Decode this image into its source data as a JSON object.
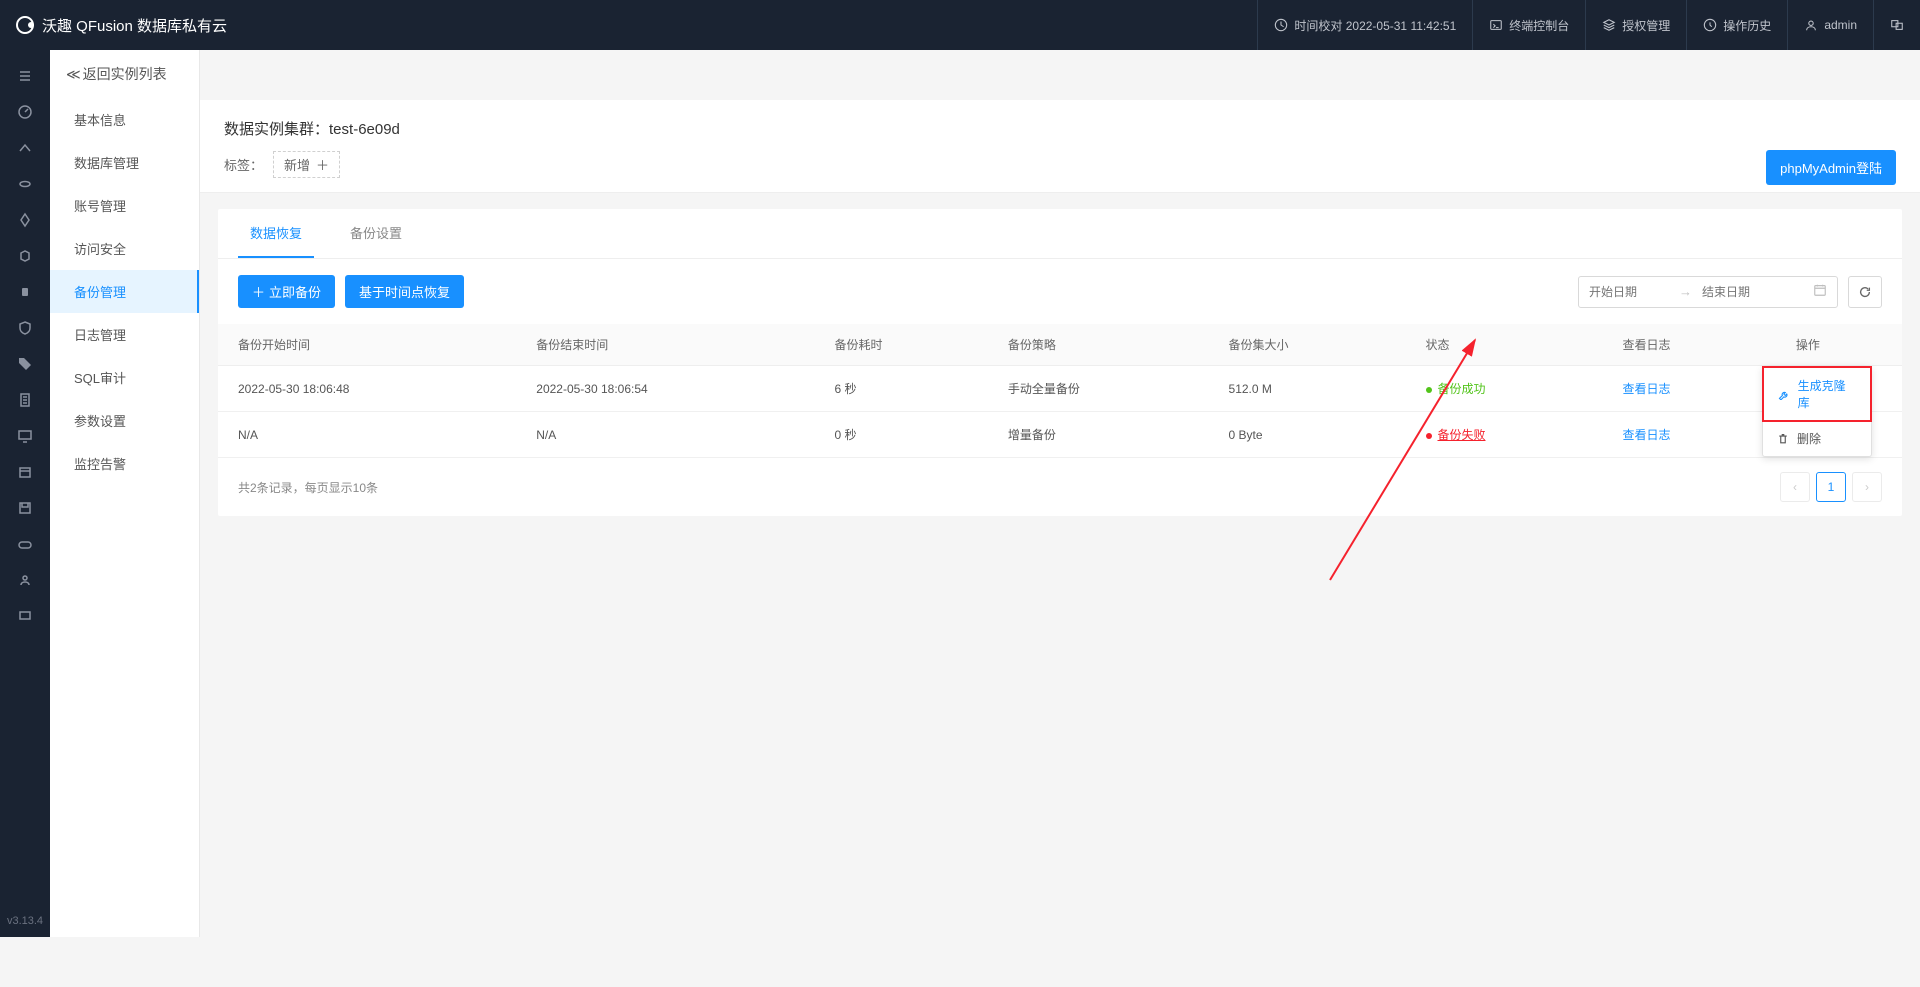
{
  "brand": "沃趣 QFusion 数据库私有云",
  "header": {
    "time_sync": "时间校对 2022-05-31 11:42:51",
    "terminal": "终端控制台",
    "license": "授权管理",
    "history": "操作历史",
    "user": "admin"
  },
  "version": "v3.13.4",
  "sidemenu": {
    "back": "返回实例列表",
    "items": [
      "基本信息",
      "数据库管理",
      "账号管理",
      "访问安全",
      "备份管理",
      "日志管理",
      "SQL审计",
      "参数设置",
      "监控告警"
    ],
    "active_index": 4
  },
  "page": {
    "title_prefix": "数据实例集群：",
    "cluster_name": "test-6e09d",
    "tags_label": "标签：",
    "tag_add": "新增",
    "login_btn": "phpMyAdmin登陆"
  },
  "tabs": {
    "active": "数据恢复",
    "other": "备份设置"
  },
  "toolbar": {
    "backup_now": "立即备份",
    "pitr": "基于时间点恢复",
    "start_date_ph": "开始日期",
    "end_date_ph": "结束日期"
  },
  "table": {
    "headers": [
      "备份开始时间",
      "备份结束时间",
      "备份耗时",
      "备份策略",
      "备份集大小",
      "状态",
      "查看日志",
      "操作"
    ],
    "rows": [
      {
        "start": "2022-05-30 18:06:48",
        "end": "2022-05-30 18:06:54",
        "duration": "6 秒",
        "strategy": "手动全量备份",
        "size": "512.0 M",
        "status": "success",
        "status_text": "备份成功",
        "log": "查看日志"
      },
      {
        "start": "N/A",
        "end": "N/A",
        "duration": "0 秒",
        "strategy": "增量备份",
        "size": "0 Byte",
        "status": "fail",
        "status_text": "备份失败",
        "log": "查看日志"
      }
    ],
    "footer": "共2条记录，每页显示10条",
    "page_current": "1"
  },
  "dropdown": {
    "clone": "生成克隆库",
    "delete": "删除"
  }
}
